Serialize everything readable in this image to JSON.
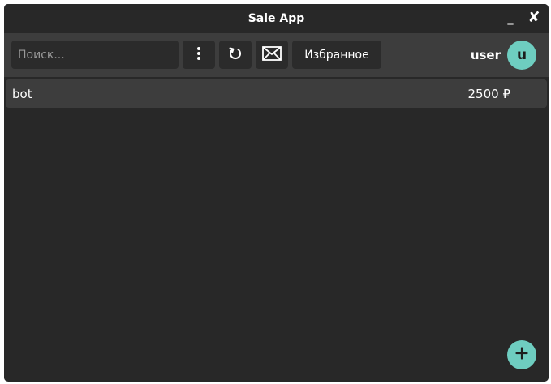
{
  "window": {
    "title": "Sale App",
    "minimize_glyph": "_",
    "close_glyph": "✘"
  },
  "toolbar": {
    "search_placeholder": "Поиск...",
    "search_value": "",
    "menu_icon": "vertical-dots-icon",
    "refresh_icon": "refresh-icon",
    "mail_icon": "envelope-icon",
    "favorites_label": "Избранное",
    "username": "user",
    "avatar_letter": "u"
  },
  "list": {
    "items": [
      {
        "name": "bot",
        "price": "2500 ₽"
      }
    ]
  },
  "fab": {
    "icon": "plus-icon"
  },
  "colors": {
    "window_bg": "#282828",
    "toolbar_bg": "#3d3d3d",
    "button_bg": "#2b2b2b",
    "accent": "#6ecdc0",
    "text": "#ffffff"
  }
}
